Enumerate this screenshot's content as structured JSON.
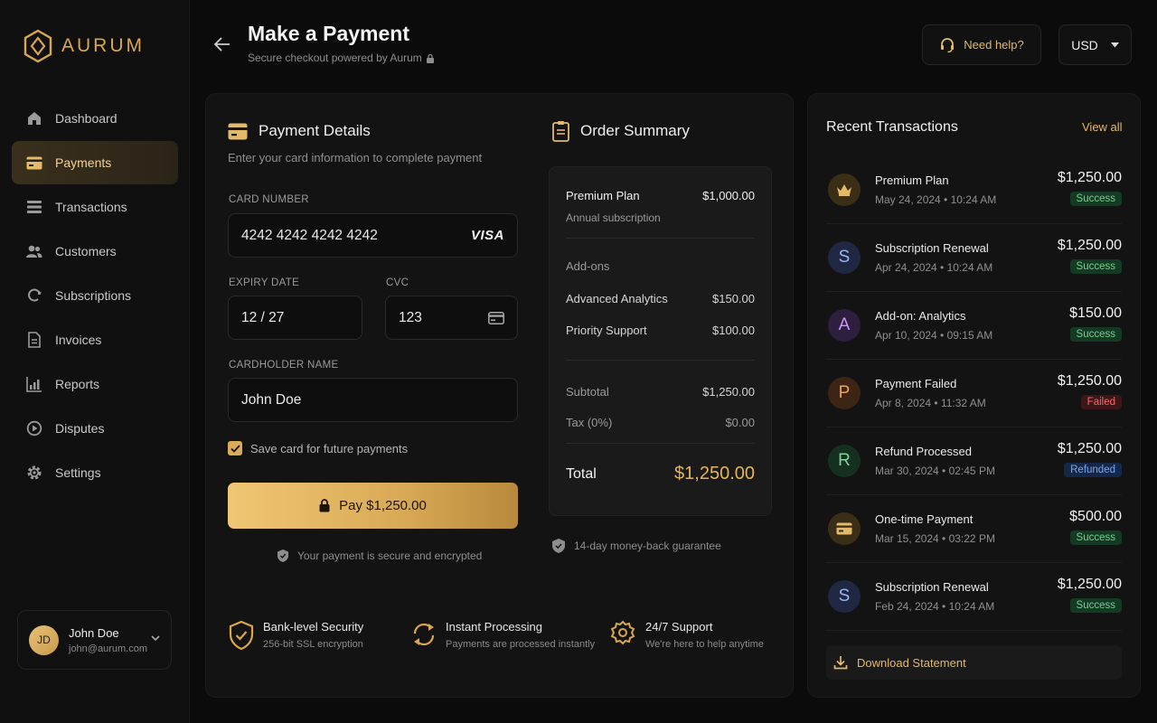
{
  "colors": {
    "accent": "#d8a64f",
    "success": "#6fd28d",
    "failed": "#f06a6a",
    "refunded": "#7aa7f0"
  },
  "brand": {
    "name": "AURUM",
    "icon": "hexagon-logo-icon"
  },
  "sidebar": {
    "items": [
      {
        "label": "Dashboard",
        "icon": "home-icon"
      },
      {
        "label": "Payments",
        "icon": "card-icon",
        "active": true
      },
      {
        "label": "Transactions",
        "icon": "transactions-icon"
      },
      {
        "label": "Customers",
        "icon": "users-icon"
      },
      {
        "label": "Subscriptions",
        "icon": "refresh-icon"
      },
      {
        "label": "Invoices",
        "icon": "invoice-icon"
      },
      {
        "label": "Reports",
        "icon": "chart-icon"
      },
      {
        "label": "Disputes",
        "icon": "dispute-icon"
      },
      {
        "label": "Settings",
        "icon": "gear-icon"
      }
    ],
    "user": {
      "initials": "JD",
      "name": "John Doe",
      "email": "john@aurum.com"
    }
  },
  "header": {
    "title": "Make a Payment",
    "subtitle": "Secure checkout powered by Aurum",
    "help_label": "Need help?",
    "currency": "USD"
  },
  "payment": {
    "title": "Payment Details",
    "subtitle": "Enter your card information to complete payment",
    "card_number_label": "CARD NUMBER",
    "card_number": "4242 4242 4242 4242",
    "card_brand": "VISA",
    "expiry_label": "EXPIRY DATE",
    "expiry": "12 / 27",
    "cvc_label": "CVC",
    "cvc": "123",
    "name_label": "CARDHOLDER NAME",
    "name": "John Doe",
    "save_card_label": "Save card for future payments",
    "save_card_checked": true,
    "pay_label": "Pay $1,250.00",
    "secure_note": "Your payment is secure and encrypted"
  },
  "summary": {
    "title": "Order Summary",
    "plan_name": "Premium Plan",
    "plan_price": "$1,000.00",
    "plan_sub": "Annual subscription",
    "addons_label": "Add-ons",
    "addons": [
      {
        "name": "Advanced Analytics",
        "price": "$150.00"
      },
      {
        "name": "Priority Support",
        "price": "$100.00"
      }
    ],
    "subtotal_label": "Subtotal",
    "subtotal": "$1,250.00",
    "tax_label": "Tax (0%)",
    "tax": "$0.00",
    "total_label": "Total",
    "total": "$1,250.00",
    "guarantee": "14-day money-back guarantee"
  },
  "features": [
    {
      "title": "Bank-level Security",
      "sub": "256-bit SSL encryption",
      "icon": "shield-check-icon"
    },
    {
      "title": "Instant Processing",
      "sub": "Payments are processed instantly",
      "icon": "sync-icon"
    },
    {
      "title": "24/7 Support",
      "sub": "We're here to help anytime",
      "icon": "support-icon"
    }
  ],
  "transactions": {
    "title": "Recent Transactions",
    "view_all": "View all",
    "items": [
      {
        "avatar": "♛",
        "avatar_type": "crown-icon",
        "name": "Premium Plan",
        "date": "May 24, 2024 • 10:24 AM",
        "amount": "$1,250.00",
        "status": "Success"
      },
      {
        "avatar": "S",
        "name": "Subscription Renewal",
        "date": "Apr 24, 2024 • 10:24 AM",
        "amount": "$1,250.00",
        "status": "Success"
      },
      {
        "avatar": "A",
        "name": "Add-on: Analytics",
        "date": "Apr 10, 2024 • 09:15 AM",
        "amount": "$150.00",
        "status": "Success"
      },
      {
        "avatar": "P",
        "name": "Payment Failed",
        "date": "Apr 8, 2024 • 11:32 AM",
        "amount": "$1,250.00",
        "status": "Failed"
      },
      {
        "avatar": "R",
        "name": "Refund Processed",
        "date": "Mar 30, 2024 • 02:45 PM",
        "amount": "$1,250.00",
        "status": "Refunded"
      },
      {
        "avatar": "▭",
        "avatar_type": "card-icon",
        "name": "One-time Payment",
        "date": "Mar 15, 2024 • 03:22 PM",
        "amount": "$500.00",
        "status": "Success"
      },
      {
        "avatar": "S",
        "name": "Subscription Renewal",
        "date": "Feb 24, 2024 • 10:24 AM",
        "amount": "$1,250.00",
        "status": "Success"
      }
    ],
    "download_label": "Download Statement"
  }
}
